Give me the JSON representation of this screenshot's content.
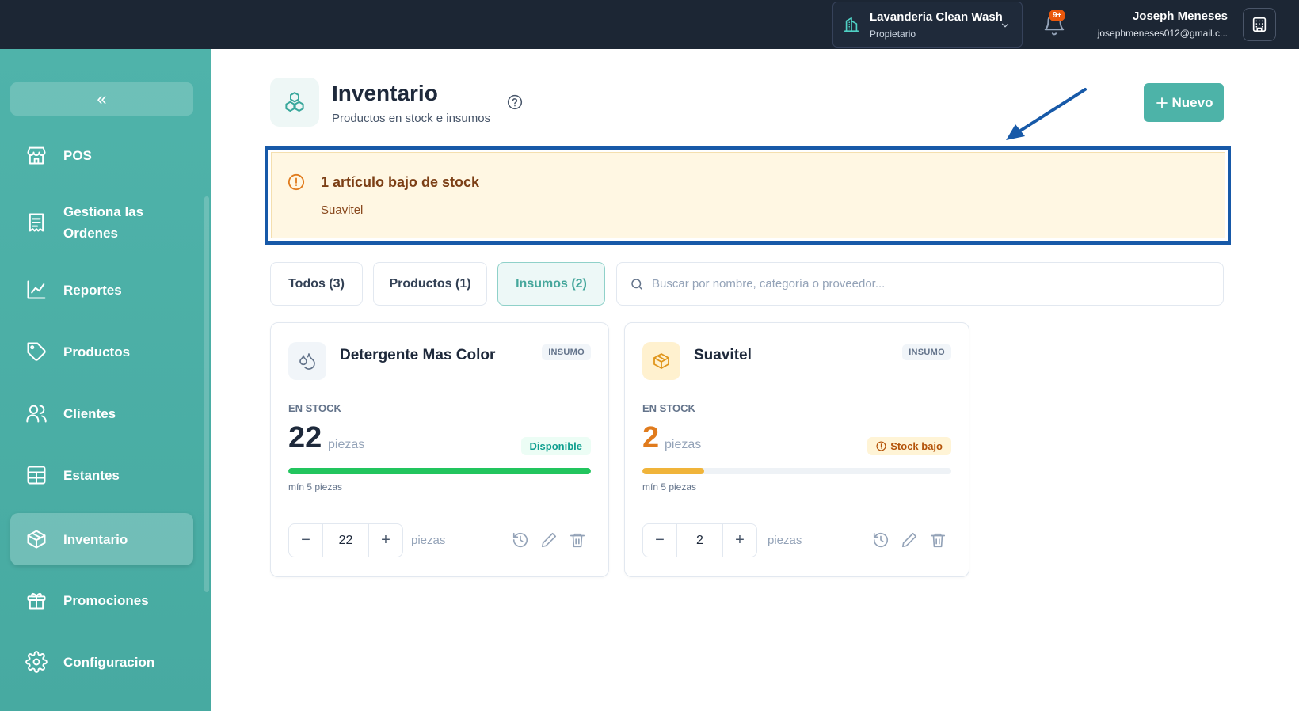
{
  "header": {
    "business_name": "Lavanderia Clean Wash",
    "business_role": "Propietario",
    "notifications_badge": "9+",
    "user_name": "Joseph Meneses",
    "user_email": "josephmeneses012@gmail.c..."
  },
  "sidebar": {
    "collapse_label": "«",
    "items": [
      {
        "label": "POS",
        "icon": "store-icon"
      },
      {
        "label": "Gestiona las Ordenes",
        "icon": "receipt-icon"
      },
      {
        "label": "Reportes",
        "icon": "chart-line-icon"
      },
      {
        "label": "Productos",
        "icon": "tag-icon"
      },
      {
        "label": "Clientes",
        "icon": "users-icon"
      },
      {
        "label": "Estantes",
        "icon": "grid-icon"
      },
      {
        "label": "Inventario",
        "icon": "box-icon",
        "active": true
      },
      {
        "label": "Promociones",
        "icon": "gift-icon"
      },
      {
        "label": "Configuracion",
        "icon": "gear-icon"
      }
    ]
  },
  "page": {
    "title": "Inventario",
    "subtitle": "Productos en stock e insumos",
    "new_button": "Nuevo"
  },
  "alert": {
    "title": "1 artículo bajo de stock",
    "items": [
      "Suavitel"
    ]
  },
  "filters": {
    "tabs": [
      {
        "label": "Todos (3)",
        "active": false
      },
      {
        "label": "Productos (1)",
        "active": false
      },
      {
        "label": "Insumos (2)",
        "active": true
      }
    ],
    "search_placeholder": "Buscar por nombre, categoría o proveedor..."
  },
  "cards": [
    {
      "name": "Detergente Mas Color",
      "type": "INSUMO",
      "stock_label": "EN STOCK",
      "quantity": "22",
      "unit": "piezas",
      "status": "Disponible",
      "status_kind": "ok",
      "stock_fraction": 1.0,
      "min_label": "mín 5 piezas",
      "stepper_value": "22",
      "stepper_unit": "piezas",
      "bar_color": "#22c55e",
      "icon": "droplets-icon"
    },
    {
      "name": "Suavitel",
      "type": "INSUMO",
      "stock_label": "EN STOCK",
      "quantity": "2",
      "unit": "piezas",
      "status": "Stock bajo",
      "status_kind": "low",
      "stock_fraction": 0.2,
      "min_label": "mín 5 piezas",
      "stepper_value": "2",
      "stepper_unit": "piezas",
      "bar_color": "#f0b43a",
      "icon": "package-icon"
    }
  ],
  "colors": {
    "topbar": "#1c2634",
    "sidebar": "#4fb3aa",
    "accent": "#4db3a8",
    "alert_frame": "#1759a8",
    "alert_bg": "#fff7e3"
  }
}
